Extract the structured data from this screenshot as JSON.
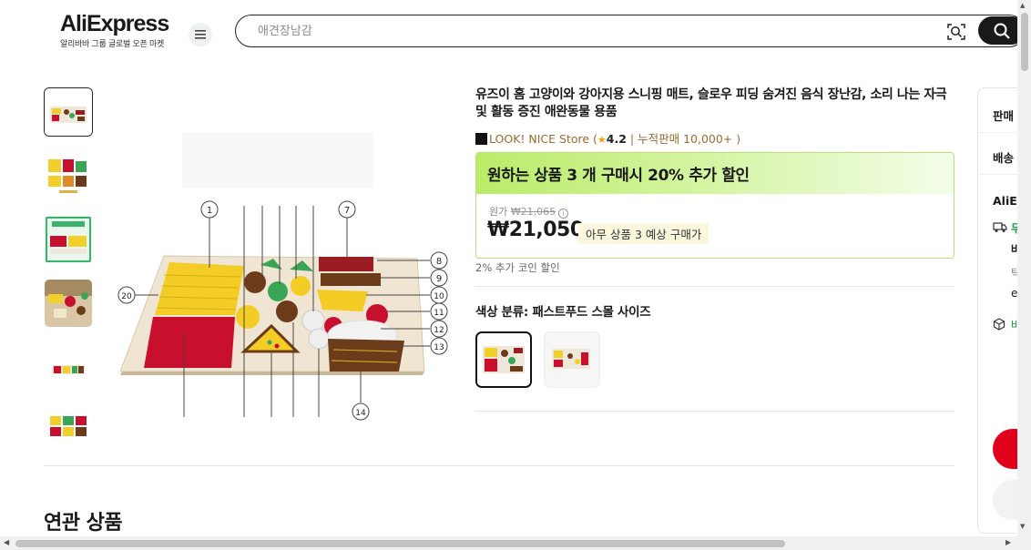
{
  "header": {
    "logo_text": "AliExpress",
    "logo_subtitle": "알리바바 그룹 글로벌 오픈 마켓",
    "search_placeholder": "애견장남감",
    "icons": [
      "menu-icon",
      "camera-search-icon",
      "search-icon"
    ]
  },
  "gallery": {
    "thumbnail_count": 6,
    "active_index": 0,
    "main_image_labels": [
      "1",
      "7",
      "8",
      "9",
      "20",
      "10",
      "11",
      "12",
      "13",
      "14"
    ]
  },
  "product": {
    "title": "유즈이 홈 고양이와 강아지용 스니핑 매트, 슬로우 피딩 숨겨진 음식 장난감, 소리 나는 자극 및 활동 증진 애완동물 용품",
    "store_name": "LOOK! NICE Store (",
    "rating": "4.2",
    "sales": " | 누적판매 10,000+ )",
    "promo_headline": "원하는 상품 3 개 구매시 20% 추가 할인",
    "original_price_label": "원가",
    "original_price": "₩21,065",
    "price": "₩21,050",
    "price_note": "아무 상품 3 예상 구매가",
    "coin_note": "2% 추가 코인 할인",
    "variant_label": "색상 분류: 패스트푸드 스몰 사이즈",
    "variant_selected_index": 0
  },
  "right_panel": {
    "seller_label": "판매",
    "shipping_label": "배송",
    "ali_label": "AliE",
    "items": [
      "무",
      "바",
      "탁",
      "e",
      "바"
    ]
  },
  "related_title": "연관 상품",
  "colors": {
    "accent_green": "#b9ec68",
    "brand_red": "#e1001b",
    "store_gold": "#9a6b2f"
  }
}
